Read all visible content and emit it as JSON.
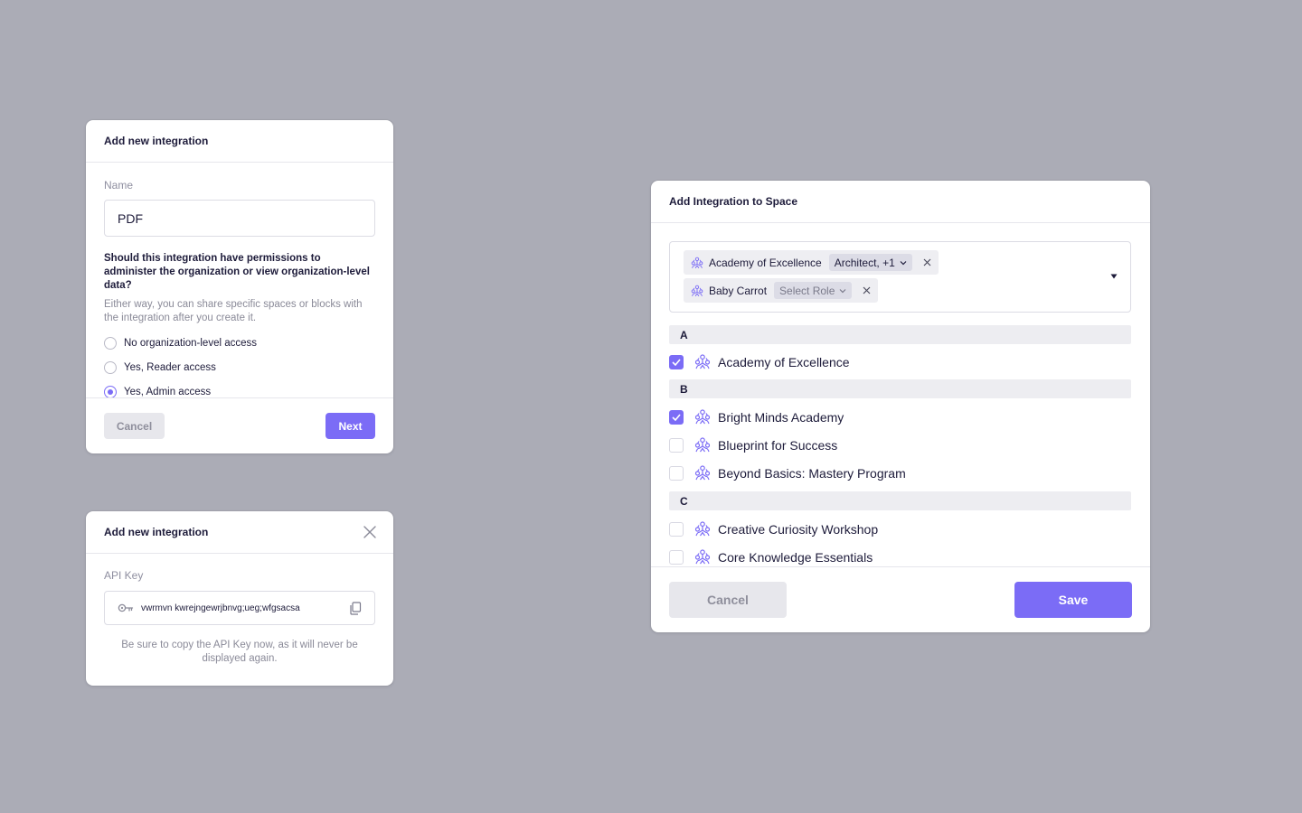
{
  "colors": {
    "accent": "#7b6cf6",
    "background": "#abacb6",
    "muted_button": "#e7e7ec"
  },
  "card1": {
    "title": "Add new integration",
    "name_label": "Name",
    "name_value": "PDF",
    "question": "Should this integration have permissions to administer the organization or view organization-level data?",
    "help": "Either way, you can share specific spaces or blocks with the integration after you create it.",
    "options": [
      {
        "label": "No organization-level access",
        "checked": false
      },
      {
        "label": "Yes, Reader access",
        "checked": false
      },
      {
        "label": "Yes, Admin access",
        "checked": true
      }
    ],
    "cancel": "Cancel",
    "next": "Next"
  },
  "card2": {
    "title": "Add new integration",
    "close_icon": "close-icon",
    "api_key_label": "API Key",
    "api_key_value": "vwrmvn kwrejngewrjbnvg;ueg;wfgsacsa",
    "key_icon": "key-icon",
    "copy_icon": "copy-icon",
    "note": "Be sure to copy the API Key now, as it will never be displayed again."
  },
  "card3": {
    "title": "Add Integration to Space",
    "selected": [
      {
        "name": "Academy of Excellence",
        "role": "Architect, +1"
      },
      {
        "name": "Baby Carrot",
        "role": "Select Role"
      }
    ],
    "groups": [
      {
        "letter": "A",
        "items": [
          {
            "name": "Academy of Excellence",
            "checked": true
          }
        ]
      },
      {
        "letter": "B",
        "items": [
          {
            "name": "Bright Minds Academy",
            "checked": true
          },
          {
            "name": "Blueprint for Success",
            "checked": false
          },
          {
            "name": "Beyond Basics: Mastery Program",
            "checked": false
          }
        ]
      },
      {
        "letter": "C",
        "items": [
          {
            "name": "Creative Curiosity Workshop",
            "checked": false
          },
          {
            "name": "Core Knowledge Essentials",
            "checked": false
          }
        ]
      }
    ],
    "cancel": "Cancel",
    "save": "Save"
  }
}
